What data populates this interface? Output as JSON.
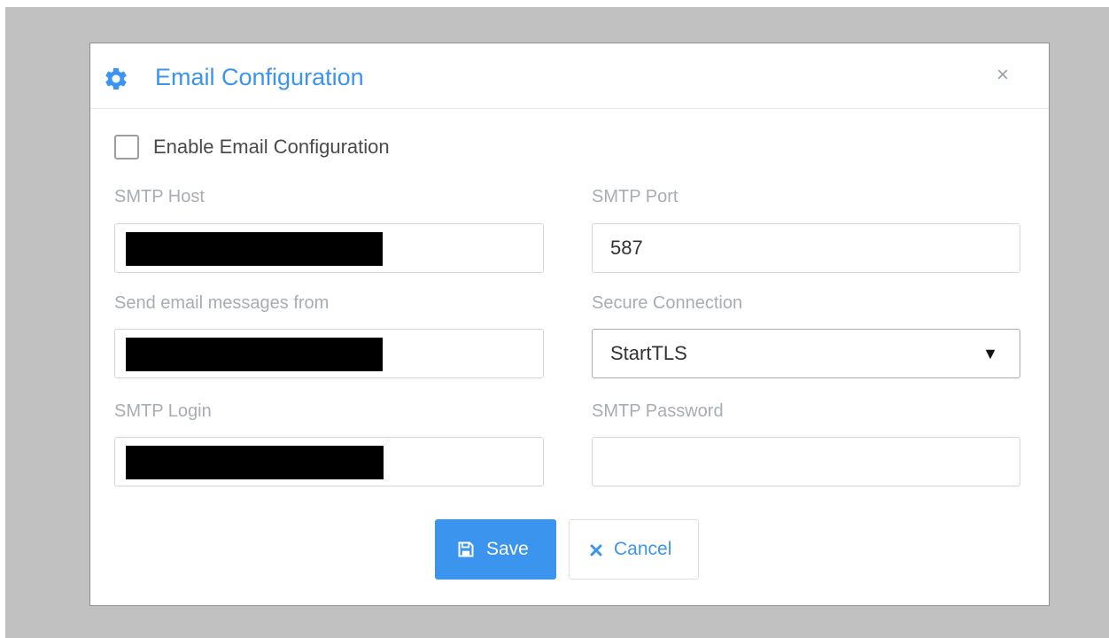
{
  "dialog": {
    "title": "Email Configuration",
    "close_label": "×",
    "icon": "gear-icon",
    "accent_color": "#3b95ef"
  },
  "enable": {
    "label": "Enable Email Configuration",
    "checked": false
  },
  "fields": {
    "smtp_host": {
      "label": "SMTP Host",
      "value": ""
    },
    "smtp_port": {
      "label": "SMTP Port",
      "value": "587"
    },
    "send_from": {
      "label": "Send email messages from",
      "value": ""
    },
    "secure_connection": {
      "label": "Secure Connection",
      "value": "StartTLS",
      "caret": "▼"
    },
    "smtp_login": {
      "label": "SMTP Login",
      "value": ""
    },
    "smtp_password": {
      "label": "SMTP Password",
      "value": ""
    }
  },
  "buttons": {
    "save_label": "Save",
    "save_icon": "save-icon",
    "cancel_label": "Cancel",
    "cancel_icon": "x-icon"
  }
}
